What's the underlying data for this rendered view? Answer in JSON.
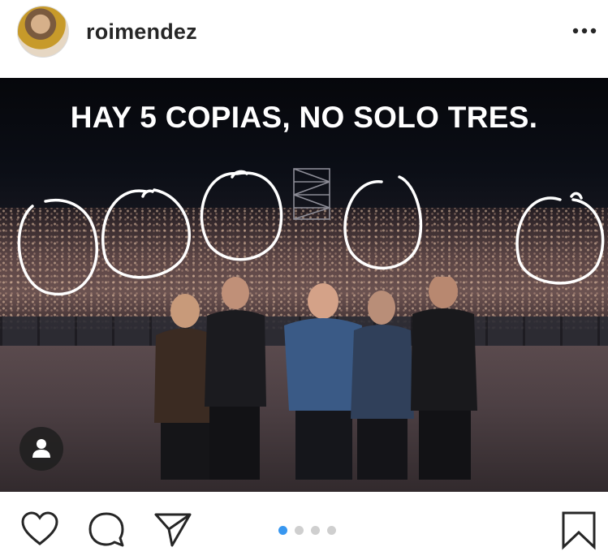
{
  "post": {
    "username": "roimendez",
    "more_icon": "more-horizontal-icon",
    "image_overlay_text": "HAY 5 COPIAS, NO SOLO TRES."
  },
  "photo": {
    "tag_people_icon": "person-icon"
  },
  "actions": {
    "like_icon": "heart-icon",
    "comment_icon": "comment-icon",
    "share_icon": "paper-plane-icon",
    "save_icon": "bookmark-icon"
  },
  "carousel": {
    "total": 4,
    "active_index": 1
  },
  "colors": {
    "carousel_active": "#3897f0",
    "carousel_inactive": "#cfcfcf",
    "username_text": "#262626"
  }
}
